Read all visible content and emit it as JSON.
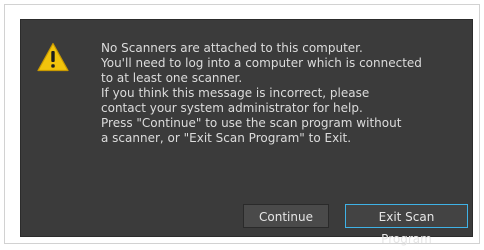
{
  "dialog": {
    "icon": "warning-icon",
    "message_lines": [
      "No Scanners are attached to this computer.",
      "You'll need to log into a computer which is connected",
      "to at least one scanner.",
      "If you think this message is incorrect, please",
      "contact your system administrator for help.",
      "Press \"Continue\" to use the scan program without",
      "a scanner, or \"Exit Scan Program\" to Exit."
    ],
    "buttons": {
      "continue_label": "Continue",
      "exit_label": "Exit Scan Program"
    }
  },
  "colors": {
    "dialog_background": "#3b3b3b",
    "text": "#dcdcdc",
    "focus_border": "#3fb2e6",
    "warning_yellow": "#f2c40c"
  }
}
